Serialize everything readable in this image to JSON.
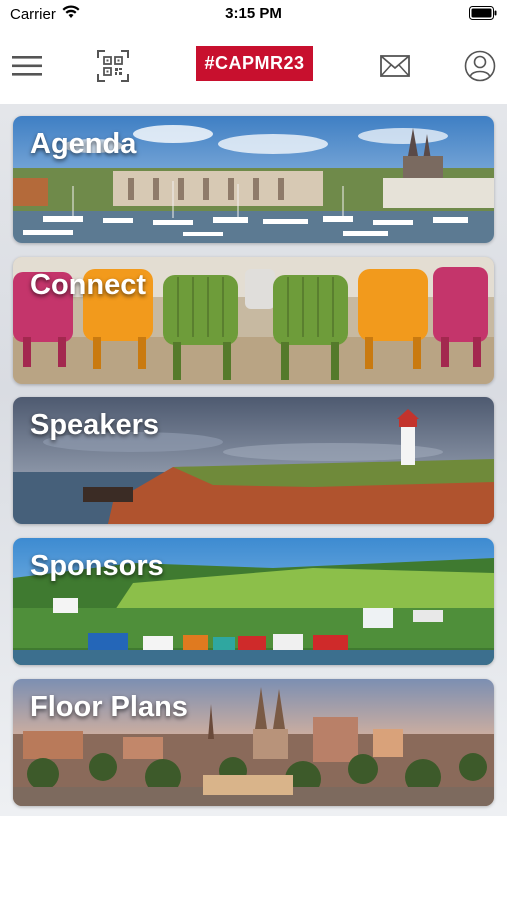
{
  "status": {
    "carrier": "Carrier",
    "time": "3:15 PM"
  },
  "header": {
    "hashtag": "#CAPMR23",
    "brand_color": "#c8102e"
  },
  "icons": {
    "menu": "hamburger-menu-icon",
    "scan": "qr-scan-icon",
    "messages": "envelope-icon",
    "profile": "user-profile-icon"
  },
  "tiles": [
    {
      "label": "Agenda"
    },
    {
      "label": "Connect"
    },
    {
      "label": "Speakers"
    },
    {
      "label": "Sponsors"
    },
    {
      "label": "Floor Plans"
    }
  ]
}
